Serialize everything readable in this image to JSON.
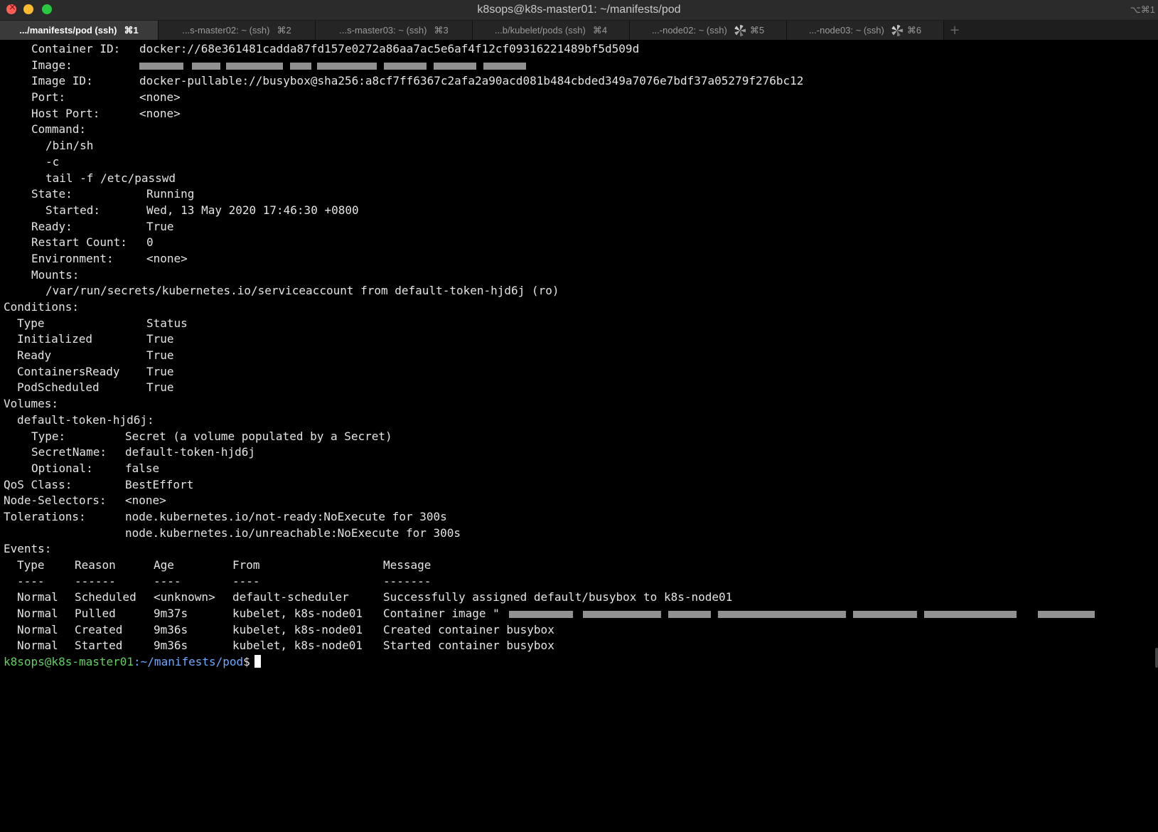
{
  "window": {
    "title": "k8sops@k8s-master01: ~/manifests/pod",
    "title_shortcut": "⌥⌘1",
    "colors": {
      "close": "#ff5f57",
      "minimize": "#febc2e",
      "zoom": "#28c840"
    }
  },
  "tabs": [
    {
      "label": ".../manifests/pod (ssh)",
      "shortcut": "⌘1",
      "active": true,
      "busy": false
    },
    {
      "label": "...s-master02: ~ (ssh)",
      "shortcut": "⌘2",
      "active": false,
      "busy": false
    },
    {
      "label": "...s-master03: ~ (ssh)",
      "shortcut": "⌘3",
      "active": false,
      "busy": false
    },
    {
      "label": "...b/kubelet/pods (ssh)",
      "shortcut": "⌘4",
      "active": false,
      "busy": false
    },
    {
      "label": "...-node02: ~ (ssh)",
      "shortcut": "⌘5",
      "active": false,
      "busy": true
    },
    {
      "label": "...-node03: ~ (ssh)",
      "shortcut": "⌘6",
      "active": false,
      "busy": true
    }
  ],
  "terminal": {
    "container": {
      "container_id_label": "Container ID:",
      "container_id": "docker://68e361481cadda87fd157e0272a86aa7ac5e6af4f12cf09316221489bf5d509d",
      "image_label": "Image:",
      "image_id_label": "Image ID:",
      "image_id": "docker-pullable://busybox@sha256:a8cf7ff6367c2afa2a90acd081b484cbded349a7076e7bdf37a05279f276bc12",
      "port_label": "Port:",
      "port": "<none>",
      "host_port_label": "Host Port:",
      "host_port": "<none>",
      "command_label": "Command:",
      "command": [
        "/bin/sh",
        "-c",
        "tail -f /etc/passwd"
      ],
      "state_label": "State:",
      "state": "Running",
      "started_label": "Started:",
      "started": "Wed, 13 May 2020 17:46:30 +0800",
      "ready_label": "Ready:",
      "ready": "True",
      "restart_label": "Restart Count:",
      "restart_count": "0",
      "environment_label": "Environment:",
      "environment": "<none>",
      "mounts_label": "Mounts:",
      "mount": "/var/run/secrets/kubernetes.io/serviceaccount from default-token-hjd6j (ro)"
    },
    "conditions": {
      "heading": "Conditions:",
      "type_header": "Type",
      "status_header": "Status",
      "rows": [
        {
          "type": "Initialized",
          "status": "True"
        },
        {
          "type": "Ready",
          "status": "True"
        },
        {
          "type": "ContainersReady",
          "status": "True"
        },
        {
          "type": "PodScheduled",
          "status": "True"
        }
      ]
    },
    "volumes": {
      "heading": "Volumes:",
      "name": "default-token-hjd6j:",
      "type_label": "Type:",
      "type": "Secret (a volume populated by a Secret)",
      "secret_label": "SecretName:",
      "secret": "default-token-hjd6j",
      "optional_label": "Optional:",
      "optional": "false"
    },
    "qos_label": "QoS Class:",
    "qos": "BestEffort",
    "node_selectors_label": "Node-Selectors:",
    "node_selectors": "<none>",
    "tolerations_label": "Tolerations:",
    "tolerations": [
      "node.kubernetes.io/not-ready:NoExecute for 300s",
      "node.kubernetes.io/unreachable:NoExecute for 300s"
    ],
    "events": {
      "heading": "Events:",
      "headers": [
        "Type",
        "Reason",
        "Age",
        "From",
        "Message"
      ],
      "underlines": [
        "----",
        "------",
        "----",
        "----",
        "-------"
      ],
      "rows": [
        {
          "type": "Normal",
          "reason": "Scheduled",
          "age": "<unknown>",
          "from": "default-scheduler",
          "message": "Successfully assigned default/busybox to k8s-node01"
        },
        {
          "type": "Normal",
          "reason": "Pulled",
          "age": "9m37s",
          "from": "kubelet, k8s-node01",
          "message": "Container image \""
        },
        {
          "type": "Normal",
          "reason": "Created",
          "age": "9m36s",
          "from": "kubelet, k8s-node01",
          "message": "Created container busybox"
        },
        {
          "type": "Normal",
          "reason": "Started",
          "age": "9m36s",
          "from": "kubelet, k8s-node01",
          "message": "Started container busybox"
        }
      ]
    },
    "prompt": {
      "user_host": "k8sops@k8s-master01",
      "path": ":~/manifests/pod",
      "symbol": "$"
    },
    "colors": {
      "foreground": "#e4e4e4",
      "background": "#000000",
      "prompt_user": "#5fd15f",
      "prompt_path": "#6fa8ff"
    }
  }
}
